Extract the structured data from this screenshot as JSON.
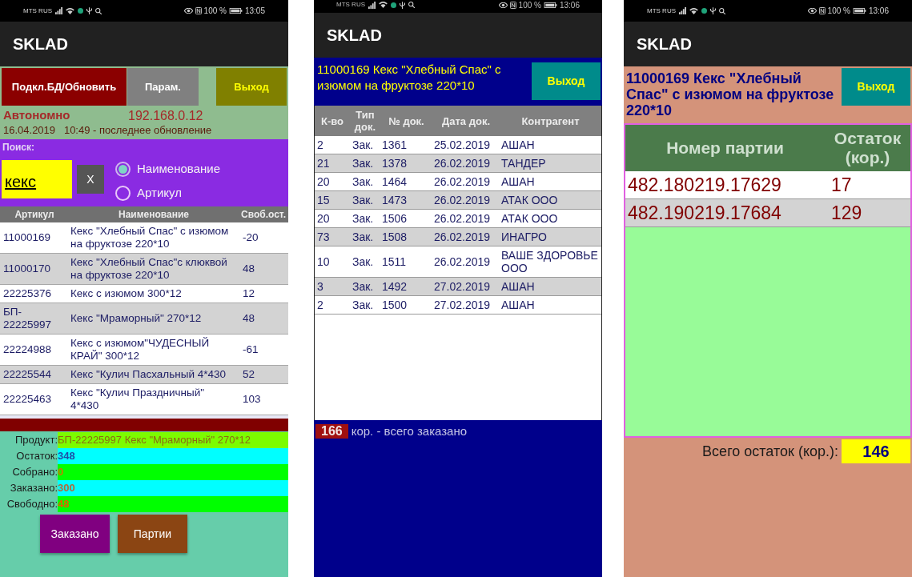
{
  "search_screen": {
    "status_bar": {
      "carrier": "MTS RUS",
      "battery": "100 %",
      "time": "13:05"
    },
    "title": "SKLAD",
    "toolbar_buttons": [
      "Подкл.БД/Обновить",
      "Парам.",
      "Выход"
    ],
    "connection_mode": "Автономно",
    "server_address": "192.168.0.12",
    "last_update": "16.04.2019   10:49 - последнее обновление",
    "search": {
      "label": "Поиск:",
      "value": "кекс",
      "clear_button": "X",
      "options": [
        {
          "label": "Наименование",
          "selected": true
        },
        {
          "label": "Артикул",
          "selected": false
        }
      ]
    },
    "table": {
      "columns": [
        "Артикул",
        "Наименование",
        "Своб.ост."
      ],
      "rows": [
        [
          "11000169",
          "Кекс \"Хлебный Спас\" с изюмом на фруктозе 220*10",
          "-20"
        ],
        [
          "11000170",
          "Кекс \"Хлебный Спас\"с клюквой на фруктозе  220*10",
          "48"
        ],
        [
          "22225376",
          "Кекс с изюмом 300*12",
          "12"
        ],
        [
          "БП-22225997",
          "Кекс \"Мраморный\" 270*12",
          "48"
        ],
        [
          "22224988",
          "Кекс с изюмом\"ЧУДЕСНЫЙ КРАЙ\" 300*12",
          "-61"
        ],
        [
          "22225544",
          "Кекс \"Кулич Пасхальный 4*430",
          "52"
        ],
        [
          "22225463",
          "Кекс \"Кулич Праздничный\" 4*430",
          "103"
        ]
      ]
    },
    "details": [
      {
        "label": "Продукт:",
        "value": "БП-22225997 Кекс \"Мраморный\" 270*12",
        "color": "#7cfc00"
      },
      {
        "label": "Остаток:",
        "value": "348",
        "color": "#00ffff"
      },
      {
        "label": "Собрано:",
        "value": "0",
        "color": "#00ff00"
      },
      {
        "label": "Заказано:",
        "value": "300",
        "color": "#00ffff"
      },
      {
        "label": "Свободно:",
        "value": "48",
        "color": "#00ff00"
      }
    ],
    "action_buttons": [
      "Заказано",
      "Партии"
    ]
  },
  "orders_screen": {
    "status_bar": {
      "carrier": "MTS RUS",
      "battery": "100 %",
      "time": "13:06"
    },
    "title": "SKLAD",
    "product": "11000169 Кекс \"Хлебный Спас\" с изюмом на фруктозе 220*10",
    "exit_button": "Выход",
    "table": {
      "columns": [
        "К-во",
        "Тип док.",
        "№ док.",
        "Дата док.",
        "Контрагент"
      ],
      "rows": [
        [
          "2",
          "Зак.",
          "1361",
          "25.02.2019",
          "АШАН"
        ],
        [
          "21",
          "Зак.",
          "1378",
          "26.02.2019",
          "ТАНДЕР"
        ],
        [
          "20",
          "Зак.",
          "1464",
          "26.02.2019",
          "АШАН"
        ],
        [
          "15",
          "Зак.",
          "1473",
          "26.02.2019",
          "АТАК  ООО"
        ],
        [
          "20",
          "Зак.",
          "1506",
          "26.02.2019",
          "АТАК  ООО"
        ],
        [
          "73",
          "Зак.",
          "1508",
          "26.02.2019",
          "ИНАГРО"
        ],
        [
          "10",
          "Зак.",
          "1511",
          "26.02.2019",
          "ВАШЕ ЗДОРОВЬЕ ООО"
        ],
        [
          "3",
          "Зак.",
          "1492",
          "27.02.2019",
          "АШАН"
        ],
        [
          "2",
          "Зак.",
          "1500",
          "27.02.2019",
          "АШАН"
        ]
      ]
    },
    "total": {
      "value": "166",
      "label": "кор. - всего заказано"
    }
  },
  "batches_screen": {
    "status_bar": {
      "carrier": "MTS RUS",
      "battery": "100 %",
      "time": "13:06"
    },
    "title": "SKLAD",
    "product": "11000169 Кекс \"Хлебный Спас\" с изюмом на фруктозе 220*10",
    "exit_button": "Выход",
    "table": {
      "columns": [
        "Номер партии",
        "Остаток (кор.)"
      ],
      "rows": [
        [
          "482.180219.17629",
          "17"
        ],
        [
          "482.190219.17684",
          "129"
        ]
      ]
    },
    "total": {
      "label": "Всего остаток (кор.):",
      "value": "146"
    }
  }
}
